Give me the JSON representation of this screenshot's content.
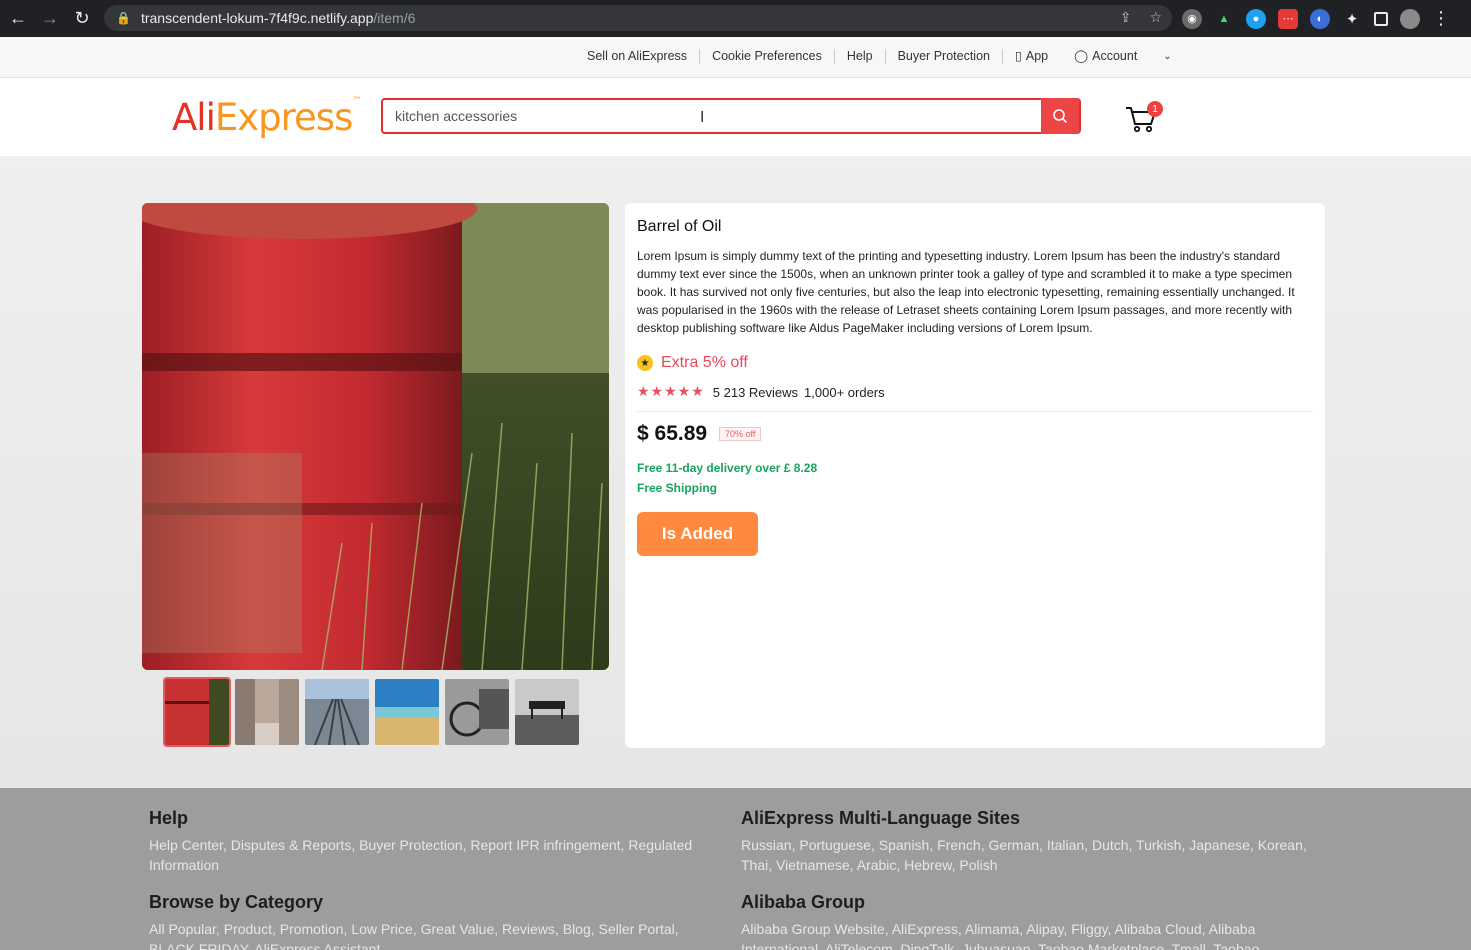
{
  "browser": {
    "url_host": "transcendent-lokum-7f4f9c.netlify.app",
    "url_path": "/item/6"
  },
  "topbar": {
    "links": [
      "Sell on AliExpress",
      "Cookie Preferences",
      "Help",
      "Buyer Protection",
      "App",
      "Account"
    ]
  },
  "header": {
    "logo_ali": "Ali",
    "logo_express": "Express",
    "logo_tm": "™",
    "search_value": "kitchen accessories",
    "cart_count": "1"
  },
  "product": {
    "title": "Barrel of Oil",
    "description": "Lorem Ipsum is simply dummy text of the printing and typesetting industry. Lorem Ipsum has been the industry's standard dummy text ever since the 1500s, when an unknown printer took a galley of type and scrambled it to make a type specimen book. It has survived not only five centuries, but also the leap into electronic typesetting, remaining essentially unchanged. It was popularised in the 1960s with the release of Letraset sheets containing Lorem Ipsum passages, and more recently with desktop publishing software like Aldus PageMaker including versions of Lorem Ipsum.",
    "promo": "Extra 5% off",
    "rating_stars": 5,
    "reviews": "5 213 Reviews",
    "orders": "1,000+ orders",
    "price": "$ 65.89",
    "discount_badge": "70% off",
    "delivery": "Free 11-day delivery over  £ 8.28",
    "shipping": "Free Shipping",
    "button_label": "Is Added",
    "thumbnails": [
      "barrel",
      "street",
      "rails",
      "beach",
      "bike",
      "pier"
    ]
  },
  "footer": {
    "sections": [
      {
        "title": "Help",
        "text": "Help Center, Disputes & Reports, Buyer Protection, Report IPR infringement, Regulated Information"
      },
      {
        "title": "AliExpress Multi-Language Sites",
        "text": "Russian, Portuguese, Spanish, French, German, Italian, Dutch, Turkish, Japanese, Korean, Thai, Vietnamese, Arabic, Hebrew, Polish"
      },
      {
        "title": "Browse by Category",
        "text": "All Popular, Product, Promotion, Low Price, Great Value, Reviews, Blog, Seller Portal, BLACK FRIDAY, AliExpress Assistant"
      },
      {
        "title": "Alibaba Group",
        "text": "Alibaba Group Website, AliExpress, Alimama, Alipay, Fliggy, Alibaba Cloud, Alibaba International, AliTelecom, DingTalk, Juhuasuan, Taobao Marketplace, Tmall, Taobao"
      }
    ]
  },
  "colors": {
    "brand_red": "#e43225",
    "brand_orange": "#f7971e",
    "button_orange": "#ff8a3d",
    "success_green": "#17a45b",
    "promo_pink": "#e5495a"
  }
}
